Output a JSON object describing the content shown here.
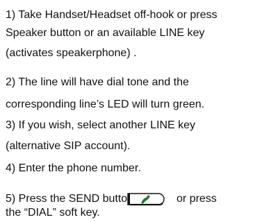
{
  "instructions": {
    "step1": {
      "line1": "1) Take Handset/Headset off-hook or press",
      "line2": "Speaker button or an available LINE key",
      "line3": "(activates speakerphone) ."
    },
    "step2": {
      "line1": "2) The line will have dial tone and the",
      "line2": "corresponding line’s  LED will turn green."
    },
    "step3": {
      "line1": "3) If you wish, select another LINE key",
      "line2": "(alternative SIP account)."
    },
    "step4": {
      "line1": "4) Enter the phone number."
    },
    "step5": {
      "line1_start": "5) Press the SEND button",
      "line1_end": "or press",
      "line2": "the “DIAL” soft key."
    }
  },
  "icons": {
    "send_button": "phone-handset-icon",
    "handset_color": "#1a7a2e"
  }
}
